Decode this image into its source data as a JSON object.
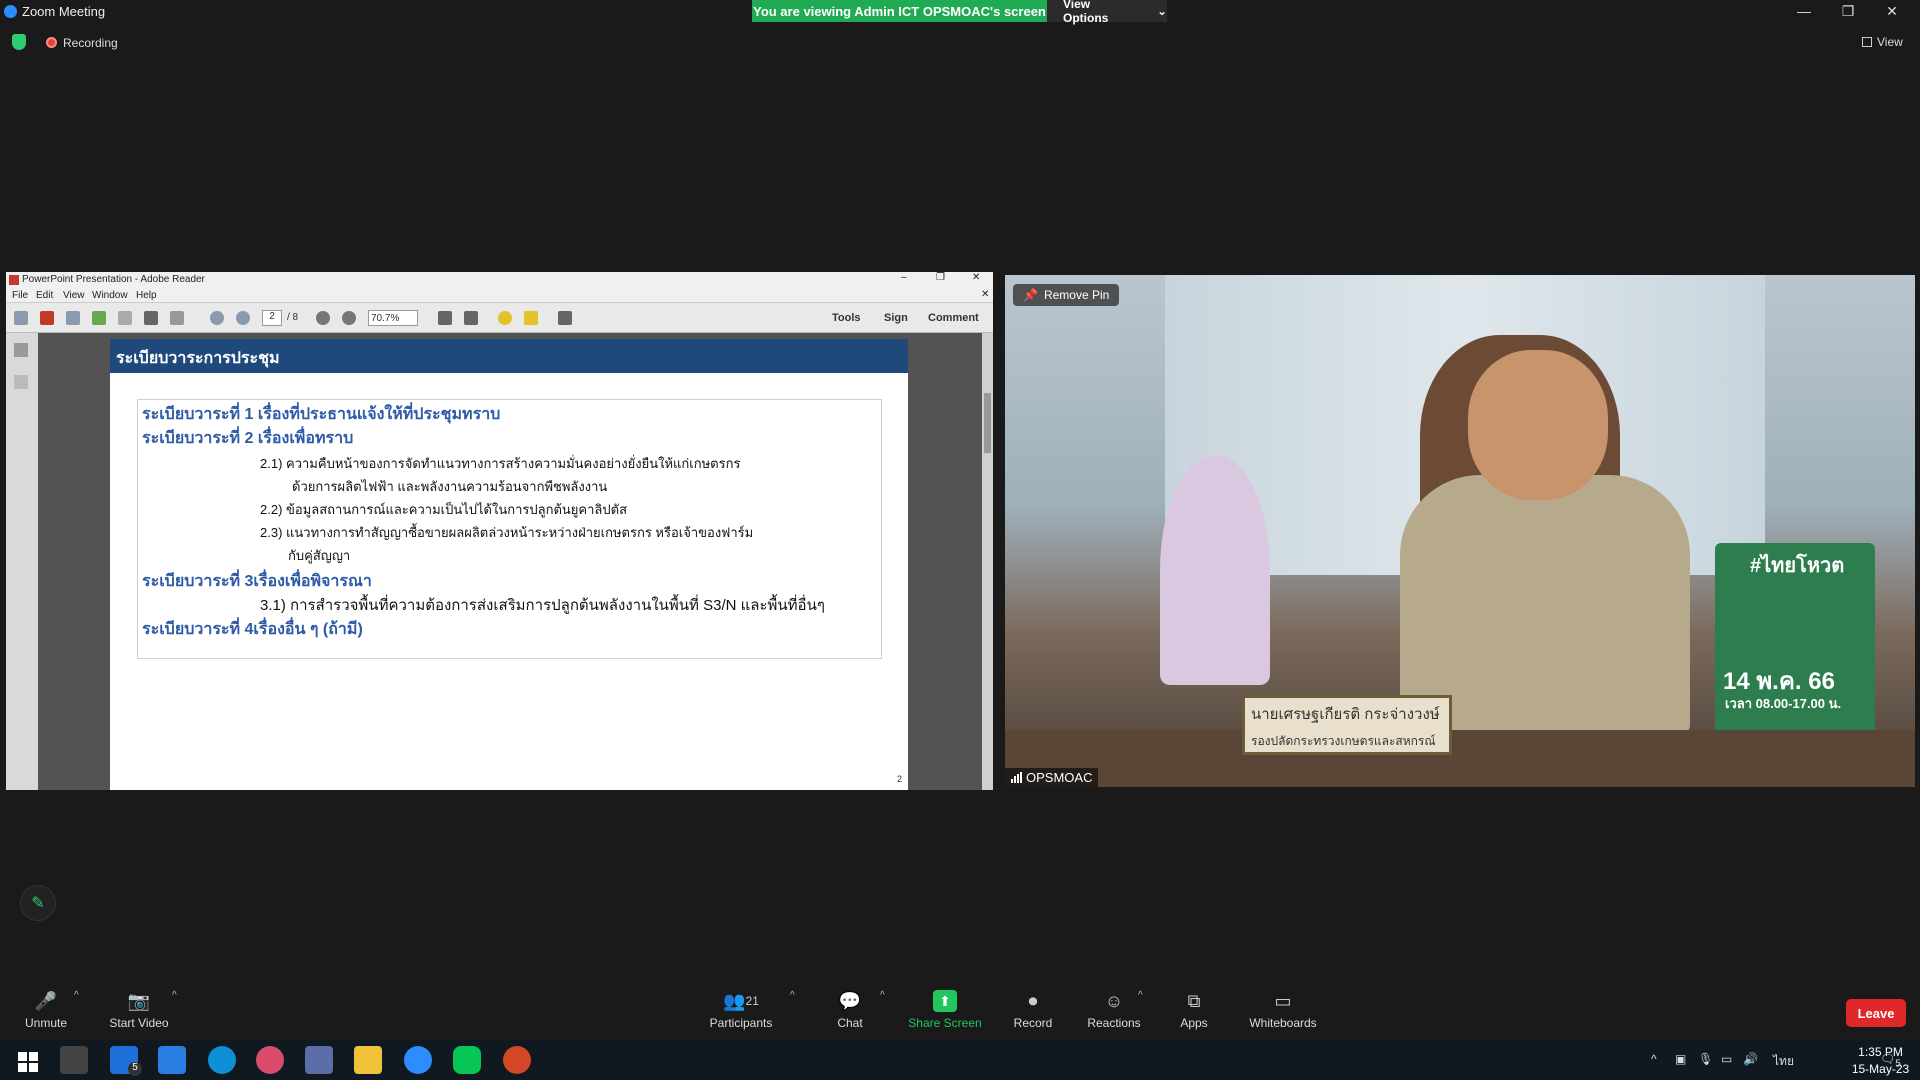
{
  "titlebar": {
    "app_title": "Zoom Meeting",
    "share_banner": "You are viewing Admin ICT OPSMOAC's screen",
    "view_options": "View Options"
  },
  "status": {
    "recording": "Recording",
    "view": "View"
  },
  "adobe": {
    "title": "PowerPoint Presentation - Adobe Reader",
    "menu": [
      "File",
      "Edit",
      "View",
      "Window",
      "Help"
    ],
    "page_current": "2",
    "page_total": "/ 8",
    "zoom": "70.7%",
    "right_tools": [
      "Tools",
      "Sign",
      "Comment"
    ]
  },
  "slide": {
    "header": "ระเบียบวาระการประชุม",
    "agenda1": "ระเบียบวาระที่ 1 เรื่องที่ประธานแจ้งให้ที่ประชุมทราบ",
    "agenda2": "ระเบียบวาระที่ 2 เรื่องเพื่อทราบ",
    "item21a": "2.1)  ความคืบหน้าของการจัดทำแนวทางการสร้างความมั่นคงอย่างยั่งยืนให้แก่เกษตรกร",
    "item21b": "ด้วยการผลิตไฟฟ้า และพลังงานความร้อนจากพืชพลังงาน",
    "item22": "2.2)  ข้อมูลสถานการณ์และความเป็นไปได้ในการปลูกต้นยูคาลิปตัส",
    "item23a": "2.3)  แนวทางการทำสัญญาซื้อขายผลผลิตล่วงหน้าระหว่างฝ่ายเกษตรกร หรือเจ้าของฟาร์ม",
    "item23b": "กับคู่สัญญา",
    "agenda3": "ระเบียบวาระที่ 3เรื่องเพื่อพิจารณา",
    "item31": "3.1) การสำรวจพื้นที่ความต้องการส่งเสริมการปลูกต้นพลังงานในพื้นที่ S3/N และพื้นที่อื่นๆ",
    "agenda4": "ระเบียบวาระที่ 4เรื่องอื่น ๆ (ถ้ามี)",
    "page_number": "2"
  },
  "video": {
    "remove_pin": "Remove Pin",
    "participant_name": "OPSMOAC",
    "nameplate_line1": "นายเศรษฐเกียรติ กระจ่างวงษ์",
    "nameplate_line2": "รองปลัดกระทรวงเกษตรและสหกรณ์",
    "poster_tag": "#ไทยโหวต",
    "poster_date": "14 พ.ค. 66",
    "poster_time": "เวลา 08.00-17.00 น."
  },
  "controls": {
    "unmute": "Unmute",
    "start_video": "Start Video",
    "participants": "Participants",
    "participants_count": "21",
    "chat": "Chat",
    "share_screen": "Share Screen",
    "record": "Record",
    "reactions": "Reactions",
    "apps": "Apps",
    "whiteboards": "Whiteboards",
    "leave": "Leave"
  },
  "taskbar": {
    "time": "1:35 PM",
    "date": "15-May-23",
    "lang": "ไทย",
    "notifications": "5",
    "mail_badge": "5"
  },
  "colors": {
    "share_green": "#1faa53",
    "leave_red": "#e02828",
    "slide_header": "#1f497d",
    "agenda_blue": "#2e5aa8"
  }
}
